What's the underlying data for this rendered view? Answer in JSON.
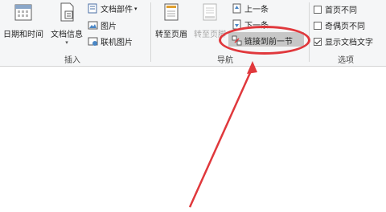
{
  "ribbon": {
    "insert_group": {
      "label": "插入",
      "date_time": "日期和时间",
      "doc_info": "文档信息",
      "doc_parts": "文档部件",
      "picture": "图片",
      "online_picture": "联机图片"
    },
    "nav_group": {
      "label": "导航",
      "goto_header": "转至页眉",
      "goto_footer": "转至页脚",
      "previous": "上一条",
      "next": "下一条",
      "link_previous": "链接到前一节"
    },
    "options_group": {
      "label": "选项",
      "different_first_page": "首页不同",
      "different_odd_even": "奇偶页不同",
      "show_doc_text": "显示文档文字",
      "different_first_page_checked": false,
      "different_odd_even_checked": false,
      "show_doc_text_checked": true
    }
  },
  "colors": {
    "annotation": "#e0383c",
    "highlight": "#c7c7c7"
  }
}
